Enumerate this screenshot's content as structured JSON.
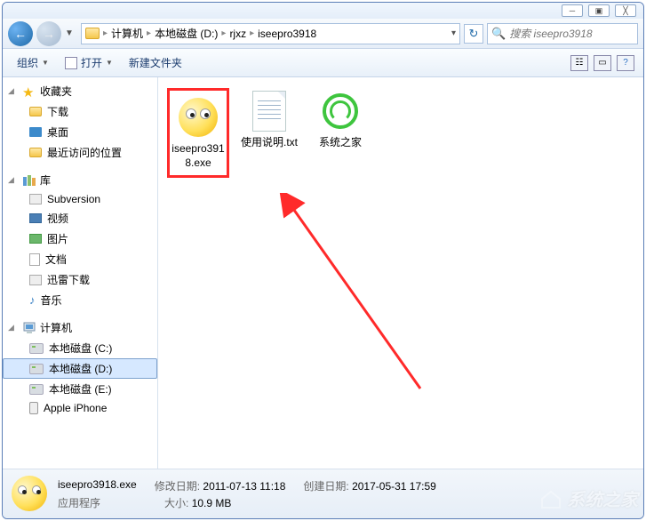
{
  "window_controls": {
    "minimize": "─",
    "maximize": "▣",
    "close": "╳"
  },
  "nav": {
    "back": "←",
    "forward": "→"
  },
  "breadcrumb": {
    "items": [
      "计算机",
      "本地磁盘 (D:)",
      "rjxz",
      "iseepro3918"
    ]
  },
  "search": {
    "placeholder": "搜索 iseepro3918"
  },
  "toolbar": {
    "organize": "组织",
    "open": "打开",
    "new_folder": "新建文件夹"
  },
  "sidebar": {
    "favorites": {
      "label": "收藏夹",
      "items": [
        "下载",
        "桌面",
        "最近访问的位置"
      ]
    },
    "libraries": {
      "label": "库",
      "items": [
        "Subversion",
        "视频",
        "图片",
        "文档",
        "迅雷下载",
        "音乐"
      ]
    },
    "computer": {
      "label": "计算机",
      "items": [
        "本地磁盘 (C:)",
        "本地磁盘 (D:)",
        "本地磁盘 (E:)",
        "Apple iPhone"
      ]
    },
    "selected": "本地磁盘 (D:)"
  },
  "files": [
    {
      "name": "iseepro3918.exe",
      "type": "exe",
      "highlighted": true
    },
    {
      "name": "使用说明.txt",
      "type": "txt"
    },
    {
      "name": "系统之家",
      "type": "url"
    }
  ],
  "details": {
    "filename": "iseepro3918.exe",
    "filetype": "应用程序",
    "modified_label": "修改日期:",
    "modified_value": "2011-07-13 11:18",
    "created_label": "创建日期:",
    "created_value": "2017-05-31 17:59",
    "size_label": "大小:",
    "size_value": "10.9 MB"
  },
  "watermark": "系统之家"
}
